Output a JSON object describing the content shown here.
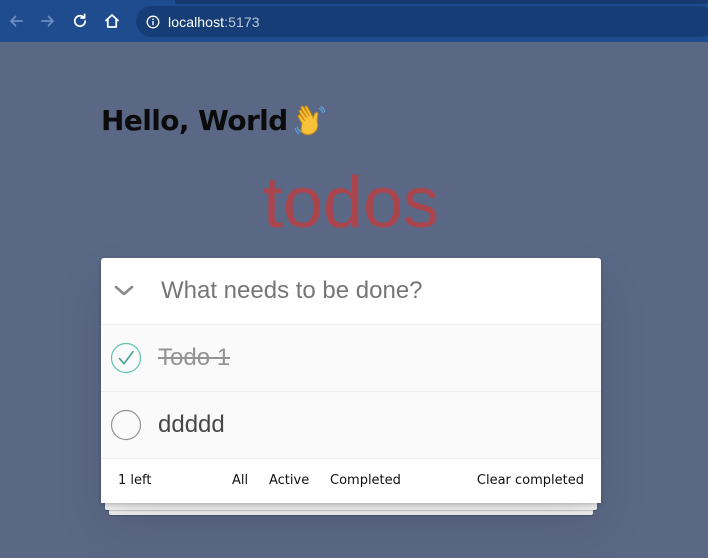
{
  "browser": {
    "url_host": "localhost",
    "url_port": ":5173"
  },
  "greeting": "Hello, World",
  "app": {
    "title": "todos",
    "accent_color": "#b83f45",
    "background_color": "#5b6885",
    "new_todo_placeholder": "What needs to be done?",
    "todos": [
      {
        "label": "Todo 1",
        "completed": true
      },
      {
        "label": "ddddd",
        "completed": false
      }
    ],
    "footer": {
      "count_label": "1 left",
      "filters": [
        "All",
        "Active",
        "Completed"
      ],
      "clear_label": "Clear completed"
    }
  },
  "icons": {
    "back": "arrow-left-icon",
    "forward": "arrow-right-icon",
    "reload": "reload-icon",
    "home": "home-icon",
    "site_info": "info-icon",
    "wave": "waving-hand-icon",
    "toggle_all": "chevron-down-icon",
    "checked": "checkmark-circle-icon",
    "unchecked": "empty-circle-icon"
  }
}
